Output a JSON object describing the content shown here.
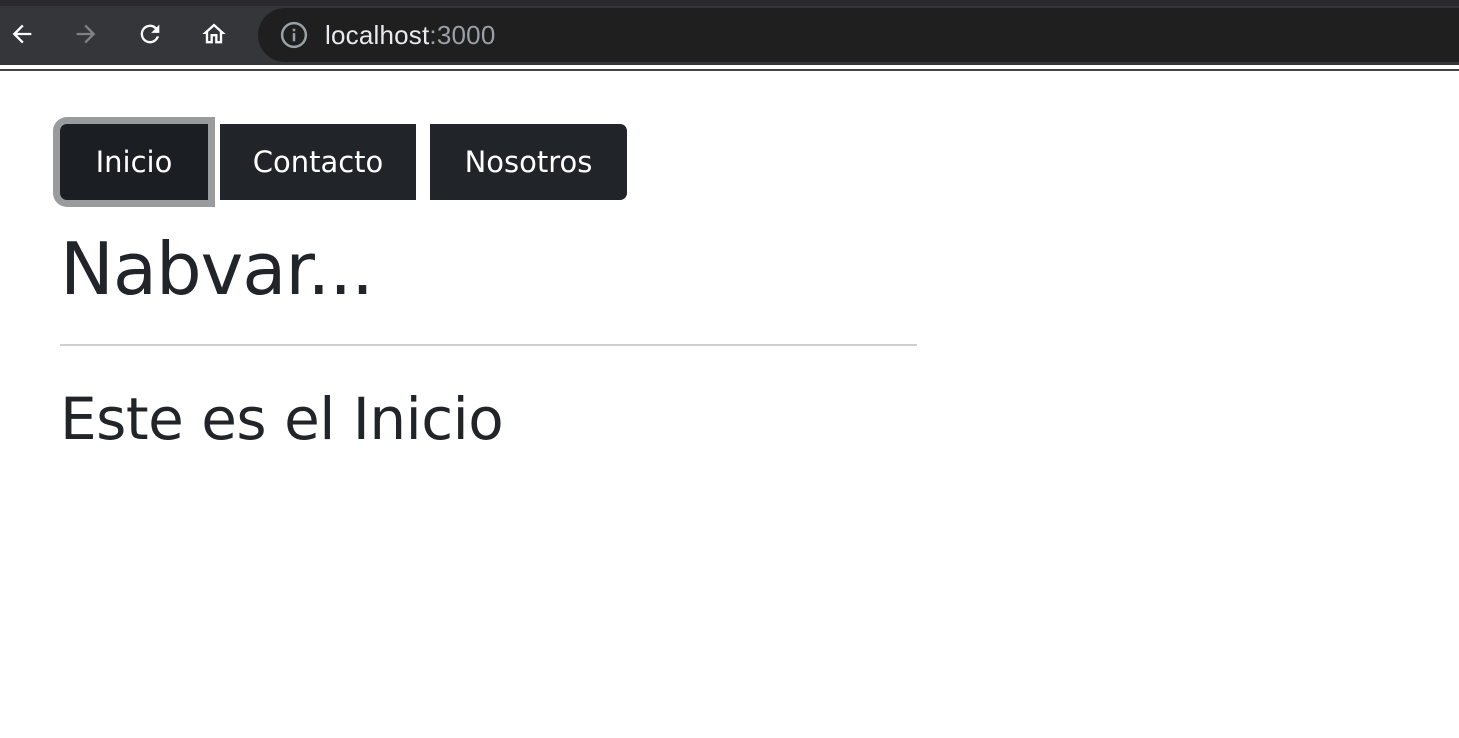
{
  "browser": {
    "url_host": "localhost",
    "url_port": ":3000",
    "icons": {
      "back": "arrow-left-icon",
      "forward": "arrow-right-icon",
      "reload": "reload-icon",
      "home": "home-icon",
      "info": "info-icon"
    }
  },
  "nav": {
    "items": [
      {
        "label": "Inicio",
        "active": true
      },
      {
        "label": "Contacto",
        "active": false
      },
      {
        "label": "Nosotros",
        "active": false
      }
    ]
  },
  "main": {
    "title": "Nabvar...",
    "subtitle": "Este es el Inicio"
  },
  "colors": {
    "button_bg": "#212529",
    "button_text": "#ffffff",
    "heading": "#212529",
    "focus_ring": "#9a9b9c"
  }
}
